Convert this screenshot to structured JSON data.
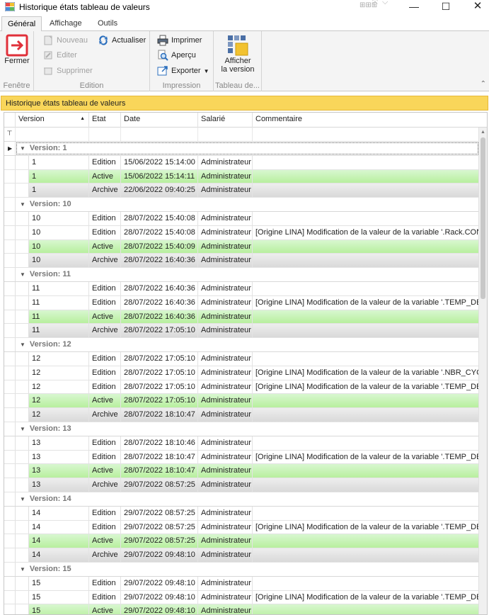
{
  "window": {
    "title": "Historique états tableau de valeurs",
    "extra_glyphs": [
      "⊞⊞⊞",
      "⤧",
      "⌵"
    ],
    "minimize": "—",
    "maximize": "☐",
    "close": "✕"
  },
  "ribbon": {
    "tabs": [
      "Général",
      "Affichage",
      "Outils"
    ],
    "groups": {
      "fenetre": {
        "label": "Fenêtre",
        "fermer": "Fermer"
      },
      "edition": {
        "label": "Edition",
        "nouveau": "Nouveau",
        "editer": "Editer",
        "supprimer": "Supprimer",
        "actualiser": "Actualiser"
      },
      "impression": {
        "label": "Impression",
        "imprimer": "Imprimer",
        "apercu": "Aperçu",
        "exporter": "Exporter"
      },
      "tableau": {
        "label": "Tableau de...",
        "afficher_line1": "Afficher",
        "afficher_line2": "la version"
      }
    }
  },
  "panel": {
    "title": "Historique états tableau de valeurs"
  },
  "grid": {
    "columns": [
      "Version",
      "Etat",
      "Date",
      "Salarié",
      "Commentaire"
    ],
    "groups": [
      {
        "label": "Version: 1",
        "rows": [
          {
            "version": "1",
            "etat": "Edition",
            "date": "15/06/2022 15:14:00",
            "salarie": "Administrateur",
            "commentaire": "",
            "state": "edition"
          },
          {
            "version": "1",
            "etat": "Active",
            "date": "15/06/2022 15:14:11",
            "salarie": "Administrateur",
            "commentaire": "",
            "state": "active"
          },
          {
            "version": "1",
            "etat": "Archive",
            "date": "22/06/2022 09:40:25",
            "salarie": "Administrateur",
            "commentaire": "",
            "state": "archive"
          }
        ]
      },
      {
        "label": "Version: 10",
        "rows": [
          {
            "version": "10",
            "etat": "Edition",
            "date": "28/07/2022 15:40:08",
            "salarie": "Administrateur",
            "commentaire": "",
            "state": "edition"
          },
          {
            "version": "10",
            "etat": "Edition",
            "date": "28/07/2022 15:40:08",
            "salarie": "Administrateur",
            "commentaire": "[Origine LINA] Modification de la valeur de la variable '.Rack.CONS...",
            "state": "edition"
          },
          {
            "version": "10",
            "etat": "Active",
            "date": "28/07/2022 15:40:09",
            "salarie": "Administrateur",
            "commentaire": "",
            "state": "active"
          },
          {
            "version": "10",
            "etat": "Archive",
            "date": "28/07/2022 16:40:36",
            "salarie": "Administrateur",
            "commentaire": "",
            "state": "archive"
          }
        ]
      },
      {
        "label": "Version: 11",
        "rows": [
          {
            "version": "11",
            "etat": "Edition",
            "date": "28/07/2022 16:40:36",
            "salarie": "Administrateur",
            "commentaire": "",
            "state": "edition"
          },
          {
            "version": "11",
            "etat": "Edition",
            "date": "28/07/2022 16:40:36",
            "salarie": "Administrateur",
            "commentaire": "[Origine LINA] Modification de la valeur de la variable '.TEMP_DE_...",
            "state": "edition"
          },
          {
            "version": "11",
            "etat": "Active",
            "date": "28/07/2022 16:40:36",
            "salarie": "Administrateur",
            "commentaire": "",
            "state": "active"
          },
          {
            "version": "11",
            "etat": "Archive",
            "date": "28/07/2022 17:05:10",
            "salarie": "Administrateur",
            "commentaire": "",
            "state": "archive"
          }
        ]
      },
      {
        "label": "Version: 12",
        "rows": [
          {
            "version": "12",
            "etat": "Edition",
            "date": "28/07/2022 17:05:10",
            "salarie": "Administrateur",
            "commentaire": "",
            "state": "edition"
          },
          {
            "version": "12",
            "etat": "Edition",
            "date": "28/07/2022 17:05:10",
            "salarie": "Administrateur",
            "commentaire": "[Origine LINA] Modification de la valeur de la variable '.NBR_CYCL...",
            "state": "edition"
          },
          {
            "version": "12",
            "etat": "Edition",
            "date": "28/07/2022 17:05:10",
            "salarie": "Administrateur",
            "commentaire": "[Origine LINA] Modification de la valeur de la variable '.TEMP_DE_...",
            "state": "edition"
          },
          {
            "version": "12",
            "etat": "Active",
            "date": "28/07/2022 17:05:10",
            "salarie": "Administrateur",
            "commentaire": "",
            "state": "active"
          },
          {
            "version": "12",
            "etat": "Archive",
            "date": "28/07/2022 18:10:47",
            "salarie": "Administrateur",
            "commentaire": "",
            "state": "archive"
          }
        ]
      },
      {
        "label": "Version: 13",
        "rows": [
          {
            "version": "13",
            "etat": "Edition",
            "date": "28/07/2022 18:10:46",
            "salarie": "Administrateur",
            "commentaire": "",
            "state": "edition"
          },
          {
            "version": "13",
            "etat": "Edition",
            "date": "28/07/2022 18:10:47",
            "salarie": "Administrateur",
            "commentaire": "[Origine LINA] Modification de la valeur de la variable '.TEMP_DE_...",
            "state": "edition"
          },
          {
            "version": "13",
            "etat": "Active",
            "date": "28/07/2022 18:10:47",
            "salarie": "Administrateur",
            "commentaire": "",
            "state": "active"
          },
          {
            "version": "13",
            "etat": "Archive",
            "date": "29/07/2022 08:57:25",
            "salarie": "Administrateur",
            "commentaire": "",
            "state": "archive"
          }
        ]
      },
      {
        "label": "Version: 14",
        "rows": [
          {
            "version": "14",
            "etat": "Edition",
            "date": "29/07/2022 08:57:25",
            "salarie": "Administrateur",
            "commentaire": "",
            "state": "edition"
          },
          {
            "version": "14",
            "etat": "Edition",
            "date": "29/07/2022 08:57:25",
            "salarie": "Administrateur",
            "commentaire": "[Origine LINA] Modification de la valeur de la variable '.TEMP_DE_...",
            "state": "edition"
          },
          {
            "version": "14",
            "etat": "Active",
            "date": "29/07/2022 08:57:25",
            "salarie": "Administrateur",
            "commentaire": "",
            "state": "active"
          },
          {
            "version": "14",
            "etat": "Archive",
            "date": "29/07/2022 09:48:10",
            "salarie": "Administrateur",
            "commentaire": "",
            "state": "archive"
          }
        ]
      },
      {
        "label": "Version: 15",
        "rows": [
          {
            "version": "15",
            "etat": "Edition",
            "date": "29/07/2022 09:48:10",
            "salarie": "Administrateur",
            "commentaire": "",
            "state": "edition"
          },
          {
            "version": "15",
            "etat": "Edition",
            "date": "29/07/2022 09:48:10",
            "salarie": "Administrateur",
            "commentaire": "[Origine LINA] Modification de la valeur de la variable '.TEMP_DE_...",
            "state": "edition"
          },
          {
            "version": "15",
            "etat": "Active",
            "date": "29/07/2022 09:48:10",
            "salarie": "Administrateur",
            "commentaire": "",
            "state": "active"
          }
        ]
      }
    ]
  },
  "colors": {
    "panel_bg": "#f9d65a",
    "active_row": "#c4f2b0",
    "archive_row": "#e2e2e2",
    "close_red": "#e0303a"
  }
}
